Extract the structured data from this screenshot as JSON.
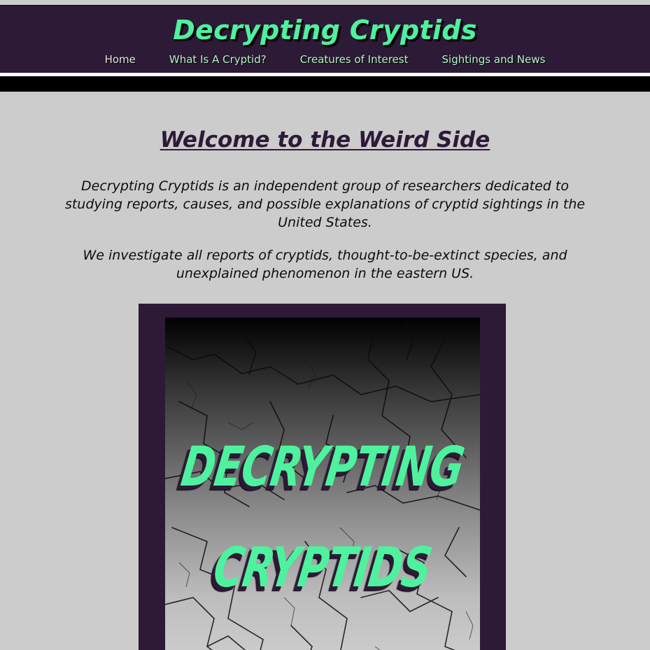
{
  "site": {
    "title": "Decrypting Cryptids"
  },
  "nav": {
    "items": [
      {
        "label": "Home"
      },
      {
        "label": "What Is A Cryptid?"
      },
      {
        "label": "Creatures of Interest"
      },
      {
        "label": "Sightings and News"
      }
    ]
  },
  "main": {
    "heading": "Welcome to the Weird Side",
    "paragraph1": "Decrypting Cryptids is an independent group of researchers dedicated to studying reports, causes, and possible explanations of cryptid sightings in the United States.",
    "paragraph2": "We investigate all reports of cryptids, thought-to-be-extinct species, and unexplained phenomenon in the eastern US."
  },
  "poster": {
    "line1": "DECRYPTING",
    "line2": "CRYPTIDS"
  },
  "colors": {
    "header_bg": "#2d1a37",
    "accent": "#4ef29e",
    "page_bg": "#cccccc"
  }
}
